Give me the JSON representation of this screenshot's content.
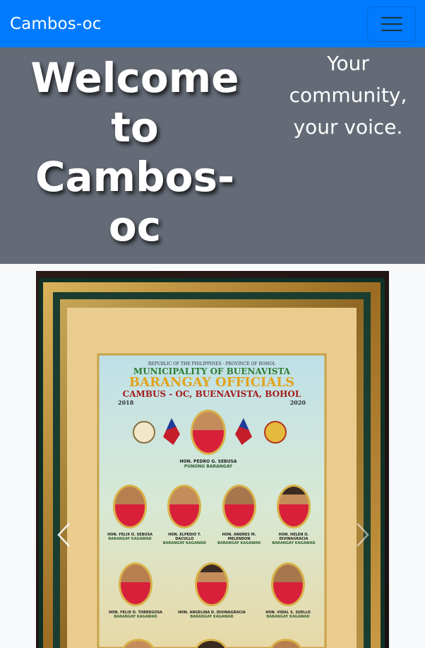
{
  "navbar": {
    "brand": "Cambos-oc",
    "toggler_icon": "hamburger-icon"
  },
  "hero": {
    "title": "Welcome to Cambos-oc",
    "tagline": "Your community, your voice."
  },
  "carousel": {
    "slide": {
      "header_small": "REPUBLIC OF THE PHILIPPINES · PROVINCE OF BOHOL",
      "municipality": "MUNICIPALITY OF BUENAVISTA",
      "title": "BARANGAY OFFICIALS",
      "place": "CAMBUS - OC, BUENAVISTA, BOHOL",
      "year_start": "2018",
      "year_end": "2020",
      "captain": {
        "name": "HON. PEDRO G. SEBUSA",
        "role": "PUNONG BARANGAY"
      },
      "row1": [
        {
          "name": "HON. FELIX O. SEBUSA",
          "role": "BARANGAY KAGAWAD"
        },
        {
          "name": "HON. ELPEDIO T. DACULLO",
          "role": "BARANGAY KAGAWAD"
        },
        {
          "name": "HON. ANDRES M. MELENDON",
          "role": "BARANGAY KAGAWAD"
        },
        {
          "name": "HON. HELEN O. DIVINAGRACIA",
          "role": "BARANGAY KAGAWAD"
        }
      ],
      "row2": [
        {
          "name": "HON. FELIX O. TORREGOSA",
          "role": "BARANGAY KAGAWAD"
        },
        {
          "name": "HON. ANGELINA D. DIVINAGRACIA",
          "role": "BARANGAY KAGAWAD"
        },
        {
          "name": "HON. VIDAL S. SUELLO",
          "role": "BARANGAY KAGAWAD"
        }
      ]
    },
    "prev_icon": "chevron-left-icon",
    "next_icon": "chevron-right-icon"
  },
  "colors": {
    "navbar": "#007bff",
    "hero": "#646b76",
    "page": "#f8f9fa",
    "frame_gold": "#b98a2e",
    "poster_title": "#e2a31b",
    "poster_green": "#2e7d32"
  }
}
